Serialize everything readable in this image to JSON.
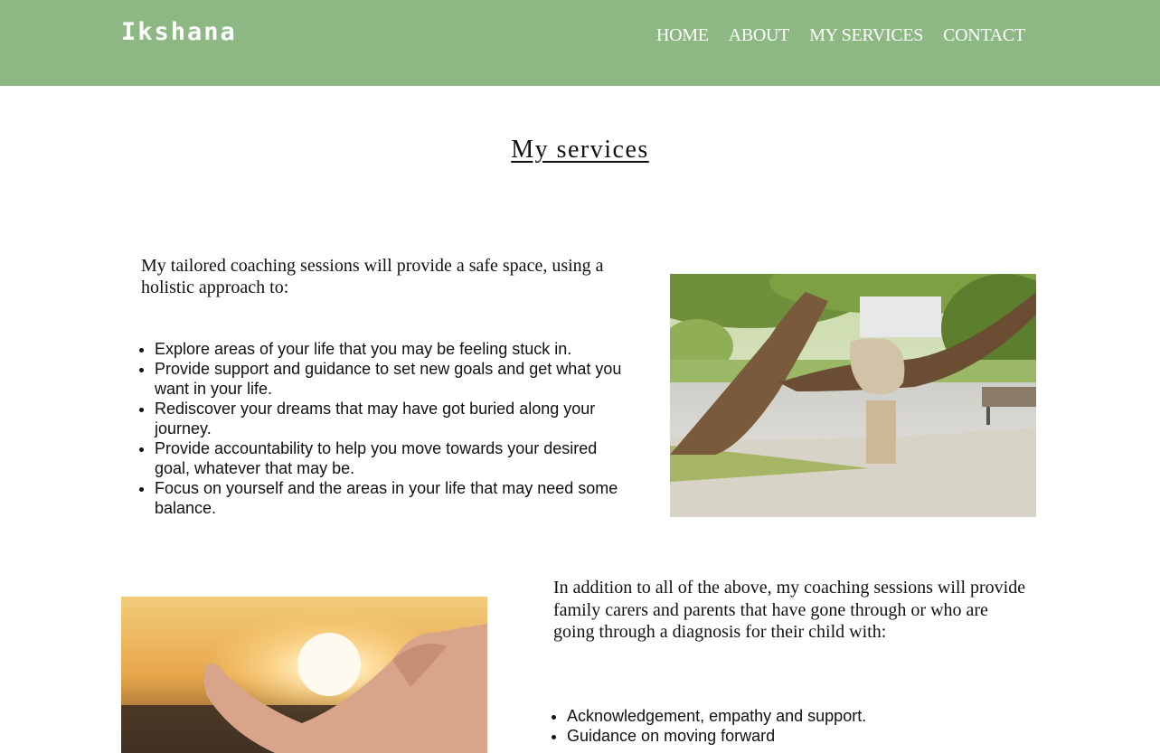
{
  "navbar": {
    "brand": "Ikshana",
    "links": [
      "HOME",
      "ABOUT",
      "MY SERVICES",
      "CONTACT"
    ],
    "background": "#8db883"
  },
  "main": {
    "title": "My services",
    "section1": {
      "intro": "My tailored coaching sessions will provide a safe space, using a holistic approach to:",
      "items": [
        "Explore areas of your life that you may be feeling stuck in.",
        "Provide support and guidance to set new goals and get what you want in your life.",
        "Rediscover your dreams that may have got buried along your journey.",
        "Provide accountability to help you move towards your desired goal, whatever that may be.",
        "Focus on yourself and the areas in your life that may need some balance."
      ]
    },
    "section2": {
      "intro": "In addition to all of the above, my coaching sessions will provide family carers and parents that have gone through or who are going through a diagnosis for their child with:",
      "items": [
        "Acknowledgement, empathy and support.",
        "Guidance on moving forward"
      ]
    }
  },
  "images": {
    "tree": "photo-tree-hand-sculpture",
    "sun": "photo-hand-sunset"
  }
}
